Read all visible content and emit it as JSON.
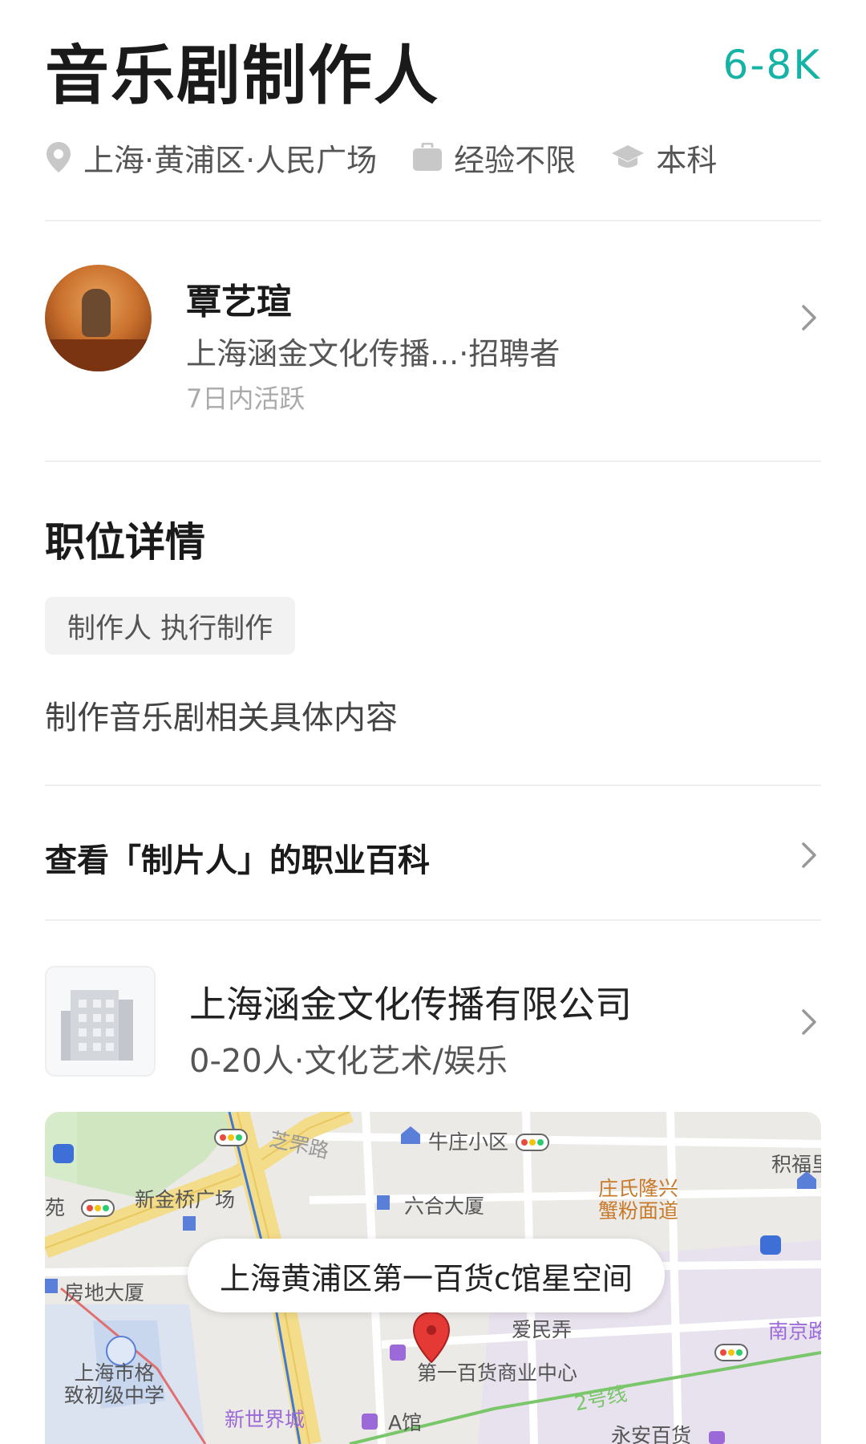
{
  "job": {
    "title": "音乐剧制作人",
    "salary": "6-8K",
    "location": "上海·黄浦区·人民广场",
    "experience": "经验不限",
    "education": "本科"
  },
  "recruiter": {
    "name": "覃艺瑄",
    "company_role": "上海涵金文化传播...·招聘者",
    "active": "7日内活跃"
  },
  "details": {
    "section_title": "职位详情",
    "tag": "制作人 执行制作",
    "description": "制作音乐剧相关具体内容"
  },
  "wiki": {
    "label": "查看「制片人」的职业百科"
  },
  "company": {
    "name": "上海涵金文化传播有限公司",
    "info": "0-20人·文化艺术/娱乐"
  },
  "map": {
    "callout": "上海黄浦区第一百货c馆星空间",
    "labels": {
      "niuzhuang": "牛庄小区",
      "zhiguo": "芝罘路",
      "jifu": "积福里",
      "xinjinqiao": "新金桥广场",
      "liuhe": "六合大厦",
      "zhuangshi": "庄氏隆兴\n蟹粉面道",
      "yuan": "苑",
      "fangdi": "房地大厦",
      "aimin": "爱民弄",
      "nanjing": "南京路",
      "shanghai_school": "上海市格\n致初级中学",
      "diyi": "第一百货商业中心",
      "xinshijie": "新世界城",
      "aguan": "A馆",
      "line2": "2号线",
      "yongan": "永安百货"
    }
  },
  "colors": {
    "salary": "#15b3a6",
    "map_pin": "#e53935",
    "poi_purple": "#9c6ad8",
    "poi_blue": "#3d6fd6"
  }
}
